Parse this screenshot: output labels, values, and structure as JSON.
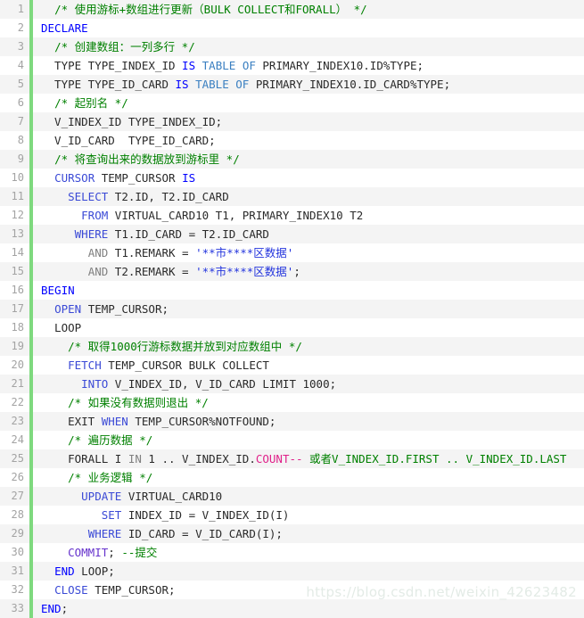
{
  "editor": {
    "language": "sql",
    "total_lines": 33,
    "gutter_color": "#a3a3a3",
    "rail_color": "#7ed97e",
    "stripe_odd": "#f4f4f4",
    "stripe_even": "#ffffff"
  },
  "watermark": {
    "text": "https://blog.csdn.net/weixin_42623482",
    "color": "#e3ebe6"
  },
  "lines": [
    {
      "n": "1",
      "tokens": [
        {
          "t": "  ",
          "c": "plain"
        },
        {
          "t": "/* 使用游标+数组进行更新（BULK COLLECT和FORALL） */",
          "c": "cmt"
        }
      ]
    },
    {
      "n": "2",
      "tokens": [
        {
          "t": "DECLARE",
          "c": "k-blue"
        }
      ]
    },
    {
      "n": "3",
      "tokens": [
        {
          "t": "  ",
          "c": "plain"
        },
        {
          "t": "/* 创建数组：一列多行 */",
          "c": "cmt"
        }
      ]
    },
    {
      "n": "4",
      "tokens": [
        {
          "t": "  TYPE TYPE_INDEX_ID ",
          "c": "plain"
        },
        {
          "t": "IS",
          "c": "k-blue"
        },
        {
          "t": " ",
          "c": "plain"
        },
        {
          "t": "TABLE",
          "c": "k-teal"
        },
        {
          "t": " ",
          "c": "plain"
        },
        {
          "t": "OF",
          "c": "k-teal"
        },
        {
          "t": " PRIMARY_INDEX10.ID%TYPE;",
          "c": "plain"
        }
      ]
    },
    {
      "n": "5",
      "tokens": [
        {
          "t": "  TYPE TYPE_ID_CARD ",
          "c": "plain"
        },
        {
          "t": "IS",
          "c": "k-blue"
        },
        {
          "t": " ",
          "c": "plain"
        },
        {
          "t": "TABLE",
          "c": "k-teal"
        },
        {
          "t": " ",
          "c": "plain"
        },
        {
          "t": "OF",
          "c": "k-teal"
        },
        {
          "t": " PRIMARY_INDEX10.ID_CARD%TYPE;",
          "c": "plain"
        }
      ]
    },
    {
      "n": "6",
      "tokens": [
        {
          "t": "  ",
          "c": "plain"
        },
        {
          "t": "/* 起别名 */",
          "c": "cmt"
        }
      ]
    },
    {
      "n": "7",
      "tokens": [
        {
          "t": "  V_INDEX_ID TYPE_INDEX_ID;",
          "c": "plain"
        }
      ]
    },
    {
      "n": "8",
      "tokens": [
        {
          "t": "  V_ID_CARD  TYPE_ID_CARD;",
          "c": "plain"
        }
      ]
    },
    {
      "n": "9",
      "tokens": [
        {
          "t": "  ",
          "c": "plain"
        },
        {
          "t": "/* 将查询出来的数据放到游标里 */",
          "c": "cmt"
        }
      ]
    },
    {
      "n": "10",
      "tokens": [
        {
          "t": "  ",
          "c": "plain"
        },
        {
          "t": "CURSOR",
          "c": "k-med"
        },
        {
          "t": " TEMP_CURSOR ",
          "c": "plain"
        },
        {
          "t": "IS",
          "c": "k-blue"
        }
      ]
    },
    {
      "n": "11",
      "tokens": [
        {
          "t": "    ",
          "c": "plain"
        },
        {
          "t": "SELECT",
          "c": "k-med"
        },
        {
          "t": " T2.ID, T2.ID_CARD",
          "c": "plain"
        }
      ]
    },
    {
      "n": "12",
      "tokens": [
        {
          "t": "      ",
          "c": "plain"
        },
        {
          "t": "FROM",
          "c": "k-med"
        },
        {
          "t": " VIRTUAL_CARD10 T1, PRIMARY_INDEX10 T2",
          "c": "plain"
        }
      ]
    },
    {
      "n": "13",
      "tokens": [
        {
          "t": "     ",
          "c": "plain"
        },
        {
          "t": "WHERE",
          "c": "k-med"
        },
        {
          "t": " T1.ID_CARD = T2.ID_CARD",
          "c": "plain"
        }
      ]
    },
    {
      "n": "14",
      "tokens": [
        {
          "t": "       ",
          "c": "plain"
        },
        {
          "t": "AND",
          "c": "gray"
        },
        {
          "t": " T1.REMARK = ",
          "c": "plain"
        },
        {
          "t": "'**市****区数据'",
          "c": "str"
        }
      ]
    },
    {
      "n": "15",
      "tokens": [
        {
          "t": "       ",
          "c": "plain"
        },
        {
          "t": "AND",
          "c": "gray"
        },
        {
          "t": " T2.REMARK = ",
          "c": "plain"
        },
        {
          "t": "'**市****区数据'",
          "c": "str"
        },
        {
          "t": ";",
          "c": "plain"
        }
      ]
    },
    {
      "n": "16",
      "tokens": [
        {
          "t": "BEGIN",
          "c": "k-blue"
        }
      ]
    },
    {
      "n": "17",
      "tokens": [
        {
          "t": "  ",
          "c": "plain"
        },
        {
          "t": "OPEN",
          "c": "k-med"
        },
        {
          "t": " TEMP_CURSOR;",
          "c": "plain"
        }
      ]
    },
    {
      "n": "18",
      "tokens": [
        {
          "t": "  LOOP",
          "c": "plain"
        }
      ]
    },
    {
      "n": "19",
      "tokens": [
        {
          "t": "    ",
          "c": "plain"
        },
        {
          "t": "/* 取得1000行游标数据并放到对应数组中 */",
          "c": "cmt"
        }
      ]
    },
    {
      "n": "20",
      "tokens": [
        {
          "t": "    ",
          "c": "plain"
        },
        {
          "t": "FETCH",
          "c": "k-med"
        },
        {
          "t": " TEMP_CURSOR BULK COLLECT",
          "c": "plain"
        }
      ]
    },
    {
      "n": "21",
      "tokens": [
        {
          "t": "      ",
          "c": "plain"
        },
        {
          "t": "INTO",
          "c": "k-med"
        },
        {
          "t": " V_INDEX_ID, V_ID_CARD LIMIT 1000;",
          "c": "plain"
        }
      ]
    },
    {
      "n": "22",
      "tokens": [
        {
          "t": "    ",
          "c": "plain"
        },
        {
          "t": "/* 如果没有数据则退出 */",
          "c": "cmt"
        }
      ]
    },
    {
      "n": "23",
      "tokens": [
        {
          "t": "    EXIT ",
          "c": "plain"
        },
        {
          "t": "WHEN",
          "c": "k-med"
        },
        {
          "t": " TEMP_CURSOR%NOTFOUND;",
          "c": "plain"
        }
      ]
    },
    {
      "n": "24",
      "tokens": [
        {
          "t": "    ",
          "c": "plain"
        },
        {
          "t": "/* 遍历数据 */",
          "c": "cmt"
        }
      ]
    },
    {
      "n": "25",
      "tokens": [
        {
          "t": "    FORALL I ",
          "c": "plain"
        },
        {
          "t": "IN",
          "c": "gray"
        },
        {
          "t": " 1 .. V_INDEX_ID.",
          "c": "plain"
        },
        {
          "t": "COUNT--",
          "c": "pink"
        },
        {
          "t": " 或者V_INDEX_ID.FIRST .. V_INDEX_ID.LAST",
          "c": "cmt"
        }
      ]
    },
    {
      "n": "26",
      "tokens": [
        {
          "t": "    ",
          "c": "plain"
        },
        {
          "t": "/* 业务逻辑 */",
          "c": "cmt"
        }
      ]
    },
    {
      "n": "27",
      "tokens": [
        {
          "t": "      ",
          "c": "plain"
        },
        {
          "t": "UPDATE",
          "c": "k-med"
        },
        {
          "t": " VIRTUAL_CARD10",
          "c": "plain"
        }
      ]
    },
    {
      "n": "28",
      "tokens": [
        {
          "t": "         ",
          "c": "plain"
        },
        {
          "t": "SET",
          "c": "k-med"
        },
        {
          "t": " INDEX_ID = V_INDEX_ID(I)",
          "c": "plain"
        }
      ]
    },
    {
      "n": "29",
      "tokens": [
        {
          "t": "       ",
          "c": "plain"
        },
        {
          "t": "WHERE",
          "c": "k-med"
        },
        {
          "t": " ID_CARD = V_ID_CARD(I);",
          "c": "plain"
        }
      ]
    },
    {
      "n": "30",
      "tokens": [
        {
          "t": "    ",
          "c": "plain"
        },
        {
          "t": "COMMIT",
          "c": "k-purple"
        },
        {
          "t": "; ",
          "c": "plain"
        },
        {
          "t": "--提交",
          "c": "cmt"
        }
      ]
    },
    {
      "n": "31",
      "tokens": [
        {
          "t": "  ",
          "c": "plain"
        },
        {
          "t": "END",
          "c": "k-blue"
        },
        {
          "t": " LOOP;",
          "c": "plain"
        }
      ]
    },
    {
      "n": "32",
      "tokens": [
        {
          "t": "  ",
          "c": "plain"
        },
        {
          "t": "CLOSE",
          "c": "k-med"
        },
        {
          "t": " TEMP_CURSOR;",
          "c": "plain"
        }
      ]
    },
    {
      "n": "33",
      "tokens": [
        {
          "t": "END",
          "c": "k-blue"
        },
        {
          "t": ";",
          "c": "plain"
        }
      ]
    }
  ]
}
